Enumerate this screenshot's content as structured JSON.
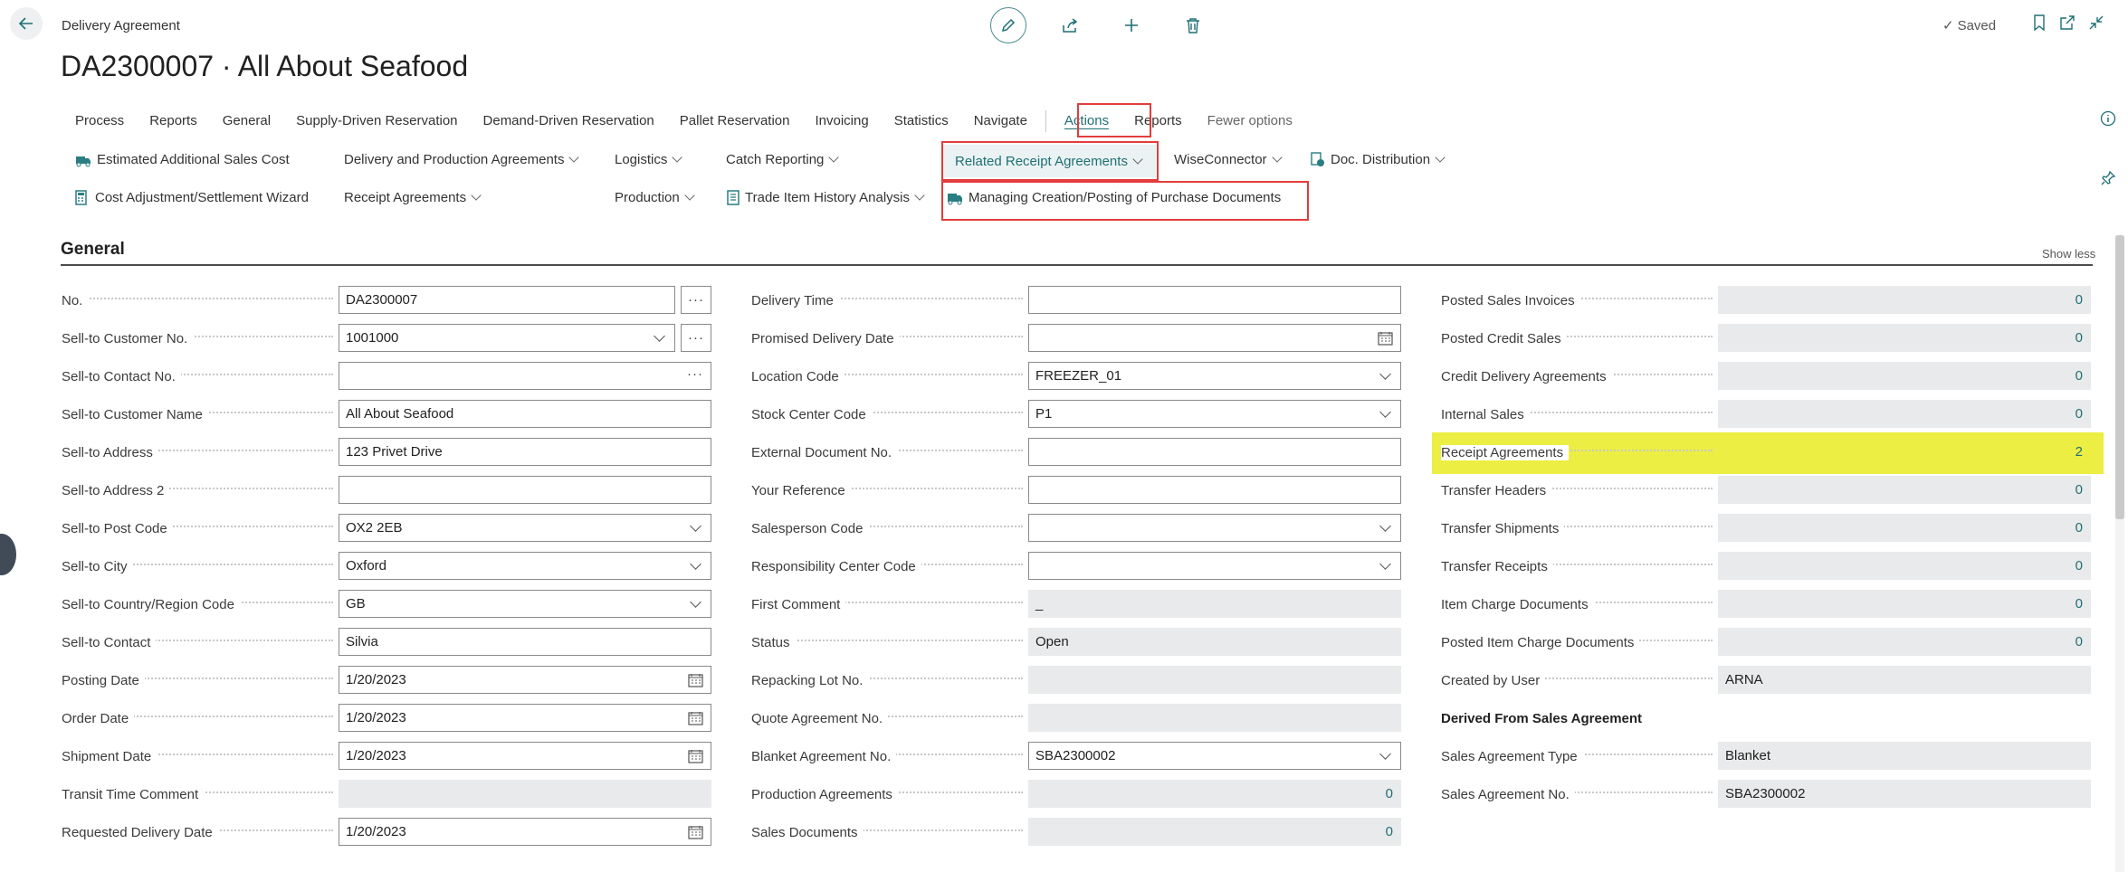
{
  "header": {
    "breadcrumb": "Delivery Agreement",
    "title": "DA2300007 · All About Seafood",
    "saved_label": "Saved"
  },
  "tabs": [
    {
      "label": "Process"
    },
    {
      "label": "Reports"
    },
    {
      "label": "General"
    },
    {
      "label": "Supply-Driven Reservation"
    },
    {
      "label": "Demand-Driven Reservation"
    },
    {
      "label": "Pallet Reservation"
    },
    {
      "label": "Invoicing"
    },
    {
      "label": "Statistics"
    },
    {
      "label": "Navigate"
    },
    {
      "label": "Actions"
    },
    {
      "label": "Reports"
    },
    {
      "label": "Fewer options"
    }
  ],
  "actions": {
    "estimated_sales_cost": "Estimated Additional Sales Cost",
    "cost_adjustment": "Cost Adjustment/Settlement Wizard",
    "delivery_production": "Delivery and Production Agreements",
    "receipt_agreements": "Receipt Agreements",
    "logistics": "Logistics",
    "production": "Production",
    "catch_reporting": "Catch Reporting",
    "trade_item_history": "Trade Item History Analysis",
    "related_receipt": "Related Receipt Agreements",
    "managing_creation": "Managing Creation/Posting of Purchase Documents",
    "wiseconnector": "WiseConnector",
    "doc_distribution": "Doc. Distribution"
  },
  "section": {
    "title": "General",
    "show_less": "Show less"
  },
  "col1": [
    {
      "label": "No.",
      "value": "DA2300007"
    },
    {
      "label": "Sell-to Customer No.",
      "value": "1001000"
    },
    {
      "label": "Sell-to Contact No.",
      "value": ""
    },
    {
      "label": "Sell-to Customer Name",
      "value": "All About Seafood"
    },
    {
      "label": "Sell-to Address",
      "value": "123 Privet Drive"
    },
    {
      "label": "Sell-to Address 2",
      "value": ""
    },
    {
      "label": "Sell-to Post Code",
      "value": "OX2 2EB"
    },
    {
      "label": "Sell-to City",
      "value": "Oxford"
    },
    {
      "label": "Sell-to Country/Region Code",
      "value": "GB"
    },
    {
      "label": "Sell-to Contact",
      "value": "Silvia"
    },
    {
      "label": "Posting Date",
      "value": "1/20/2023"
    },
    {
      "label": "Order Date",
      "value": "1/20/2023"
    },
    {
      "label": "Shipment Date",
      "value": "1/20/2023"
    },
    {
      "label": "Transit Time Comment",
      "value": ""
    },
    {
      "label": "Requested Delivery Date",
      "value": "1/20/2023"
    }
  ],
  "col2": [
    {
      "label": "Delivery Time",
      "value": ""
    },
    {
      "label": "Promised Delivery Date",
      "value": ""
    },
    {
      "label": "Location Code",
      "value": "FREEZER_01"
    },
    {
      "label": "Stock Center Code",
      "value": "P1"
    },
    {
      "label": "External Document No.",
      "value": ""
    },
    {
      "label": "Your Reference",
      "value": ""
    },
    {
      "label": "Salesperson Code",
      "value": ""
    },
    {
      "label": "Responsibility Center Code",
      "value": ""
    },
    {
      "label": "First Comment",
      "value": "_"
    },
    {
      "label": "Status",
      "value": "Open"
    },
    {
      "label": "Repacking Lot No.",
      "value": ""
    },
    {
      "label": "Quote Agreement No.",
      "value": ""
    },
    {
      "label": "Blanket Agreement No.",
      "value": "SBA2300002"
    },
    {
      "label": "Production Agreements",
      "value": "0"
    },
    {
      "label": "Sales Documents",
      "value": "0"
    }
  ],
  "col3": [
    {
      "label": "Posted Sales Invoices",
      "value": "0"
    },
    {
      "label": "Posted Credit Sales",
      "value": "0"
    },
    {
      "label": "Credit Delivery Agreements",
      "value": "0"
    },
    {
      "label": "Internal Sales",
      "value": "0"
    },
    {
      "label": "Receipt Agreements",
      "value": "2"
    },
    {
      "label": "Transfer Headers",
      "value": "0"
    },
    {
      "label": "Transfer Shipments",
      "value": "0"
    },
    {
      "label": "Transfer Receipts",
      "value": "0"
    },
    {
      "label": "Item Charge Documents",
      "value": "0"
    },
    {
      "label": "Posted Item Charge Documents",
      "value": "0"
    },
    {
      "label": "Created by User",
      "value": "ARNA"
    },
    {
      "label": "Derived From Sales Agreement",
      "value": ""
    },
    {
      "label": "Sales Agreement Type",
      "value": "Blanket"
    },
    {
      "label": "Sales Agreement No.",
      "value": "SBA2300002"
    }
  ],
  "colors": {
    "accent": "#1f6f74",
    "highlight": "#ecee43",
    "red_box": "#e23c3c"
  }
}
